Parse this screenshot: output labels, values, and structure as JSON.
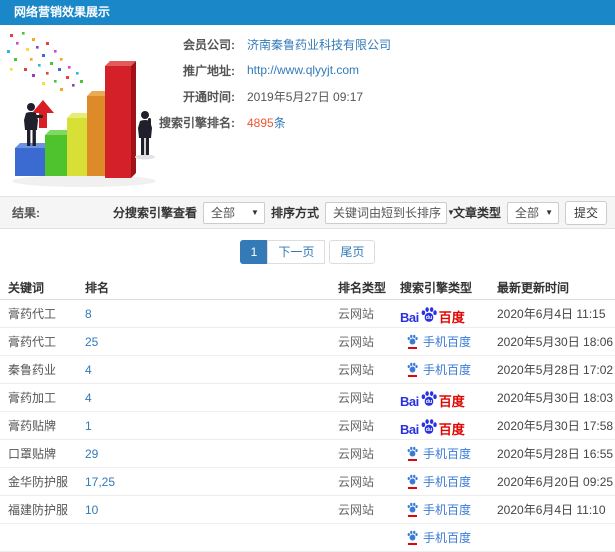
{
  "header": {
    "title": "网络营销效果展示",
    "bg_color": "#1987c8"
  },
  "info": {
    "rows": [
      {
        "label": "会员公司:",
        "value": "济南秦鲁药业科技有限公司",
        "kind": "link"
      },
      {
        "label": "推广地址:",
        "value": "http://www.qlyyjt.com",
        "kind": "link"
      },
      {
        "label": "开通时间:",
        "value": "2019年5月27日 09:17",
        "kind": "text"
      },
      {
        "label": "搜索引擎排名:",
        "value": "4895",
        "suffix": "条",
        "kind": "count"
      }
    ]
  },
  "filters": {
    "result_label": "结果:",
    "engine_label": "分搜索引擎查看",
    "engine_value": "全部",
    "sort_label": "排序方式",
    "sort_value": "关键词由短到长排序",
    "article_label": "文章类型",
    "article_value": "全部",
    "submit_label": "提交"
  },
  "pagination": {
    "current": "1",
    "next": "下一页",
    "last": "尾页"
  },
  "table": {
    "headers": [
      "关键词",
      "排名",
      "排名类型",
      "搜索引擎类型",
      "最新更新时间"
    ],
    "baidu_logo": {
      "bai": "Bai",
      "du": "du",
      "cn": "百度"
    },
    "mobile_logo_label": "手机百度",
    "rows": [
      {
        "keyword": "膏药代工",
        "rank": "8",
        "rank_type": "云网站",
        "engine": "baidu",
        "updated": "2020年6月4日 11:15"
      },
      {
        "keyword": "膏药代工",
        "rank": "25",
        "rank_type": "云网站",
        "engine": "baidu-mobile",
        "updated": "2020年5月30日 18:06"
      },
      {
        "keyword": "秦鲁药业",
        "rank": "4",
        "rank_type": "云网站",
        "engine": "baidu-mobile",
        "updated": "2020年5月28日 17:02"
      },
      {
        "keyword": "膏药加工",
        "rank": "4",
        "rank_type": "云网站",
        "engine": "baidu",
        "updated": "2020年5月30日 18:03"
      },
      {
        "keyword": "膏药贴牌",
        "rank": "1",
        "rank_type": "云网站",
        "engine": "baidu",
        "updated": "2020年5月30日 17:58"
      },
      {
        "keyword": "口罩贴牌",
        "rank": "29",
        "rank_type": "云网站",
        "engine": "baidu-mobile",
        "updated": "2020年5月28日 16:55"
      },
      {
        "keyword": "金华防护服",
        "rank": "17,25",
        "rank_type": "云网站",
        "engine": "baidu-mobile",
        "updated": "2020年6月20日 09:25"
      },
      {
        "keyword": "福建防护服",
        "rank": "10",
        "rank_type": "云网站",
        "engine": "baidu-mobile",
        "updated": "2020年6月4日 11:10"
      }
    ],
    "partial_next_row": {
      "engine": "baidu-mobile"
    }
  },
  "colors": {
    "accent_blue": "#337ab7",
    "count_red": "#f0542d",
    "baidu_blue": "#2932e1",
    "baidu_red": "#e10601",
    "mobile_blue": "#3a7bd5"
  }
}
